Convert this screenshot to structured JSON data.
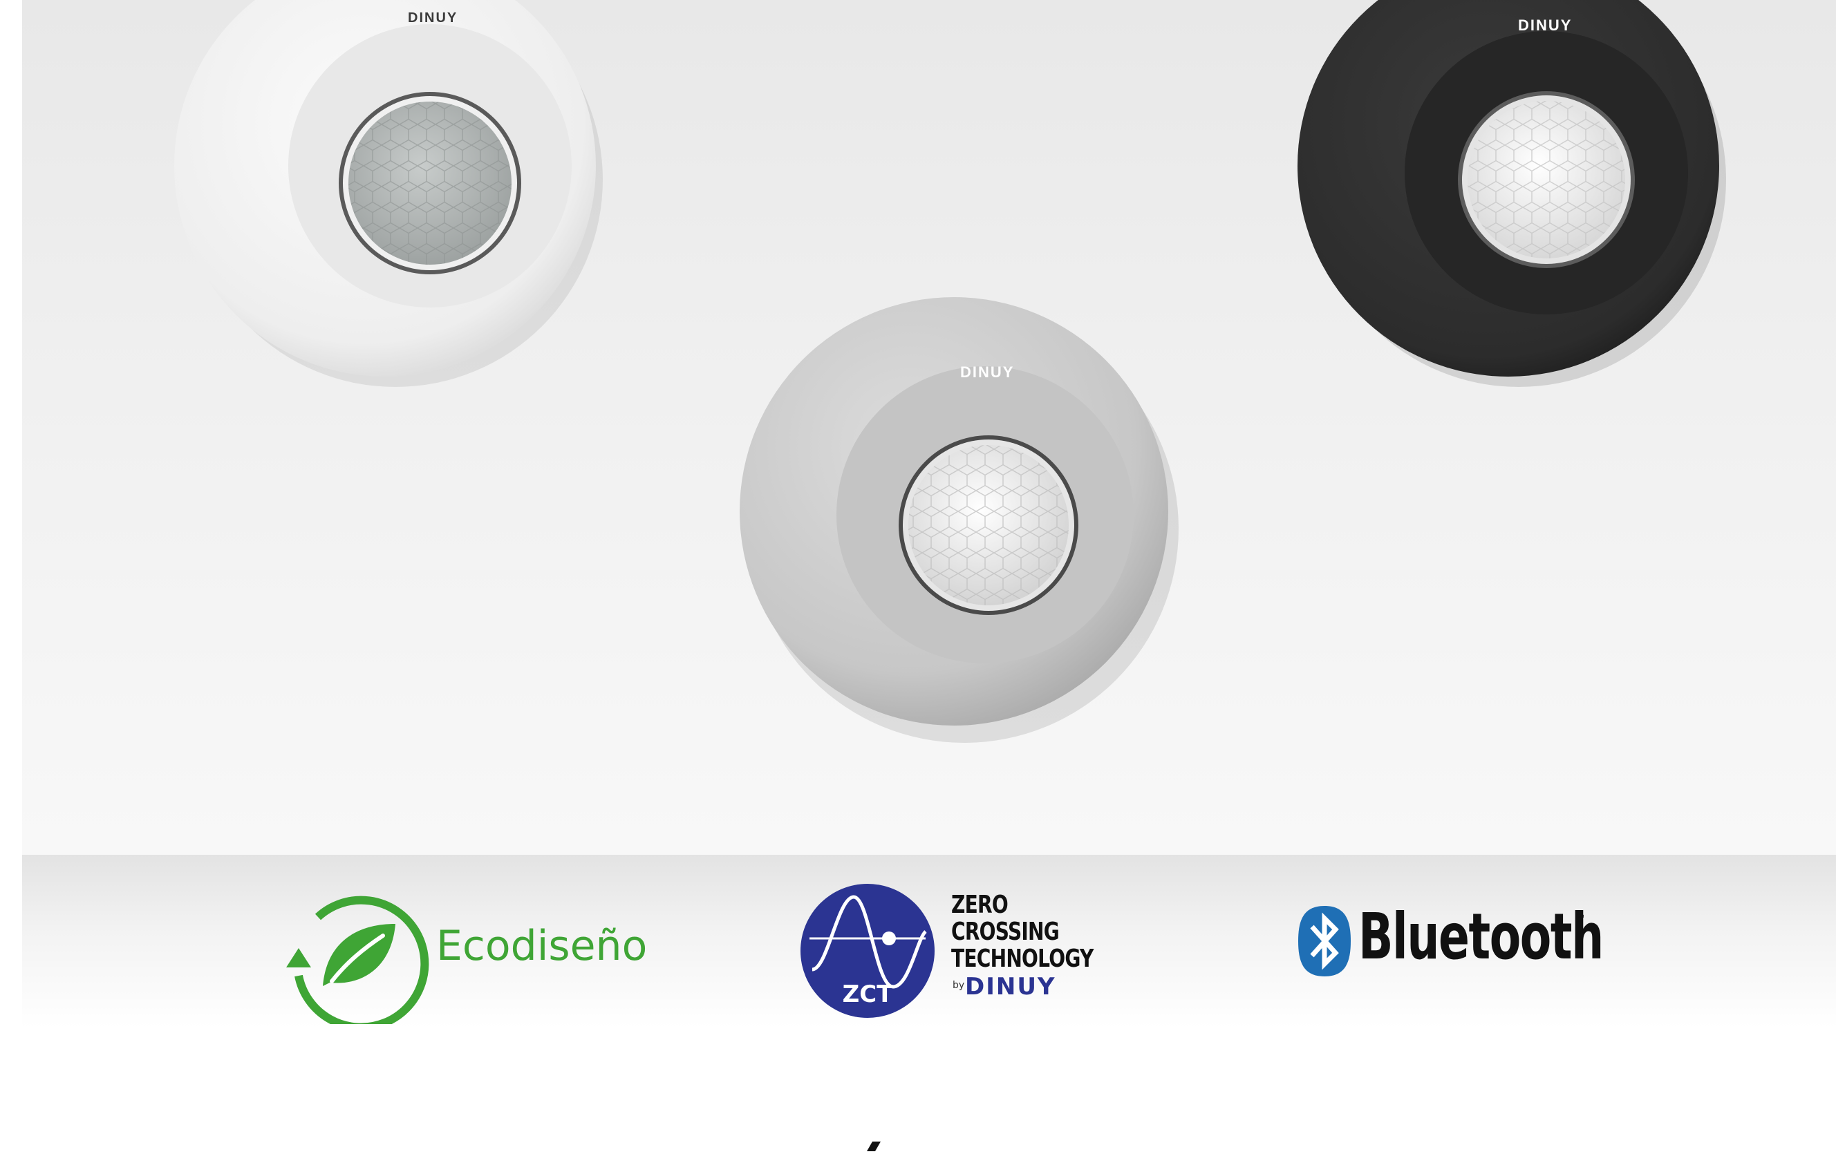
{
  "products": [
    {
      "name": "white-sensor",
      "brand": "DINUY",
      "body_color": "#f2f2f2",
      "ring_color": "#e6e6e6",
      "lens_color": "#b9bdbb"
    },
    {
      "name": "silver-sensor",
      "brand": "DINUY",
      "body_color": "#cfcfcf",
      "ring_color": "#bdbdbd",
      "lens_color": "#ececec"
    },
    {
      "name": "black-sensor",
      "brand": "DINUY",
      "body_color": "#2f2f2f",
      "ring_color": "#272727",
      "lens_color": "#f0f0f0"
    }
  ],
  "badges": {
    "eco": {
      "label": "Ecodiseño",
      "color": "#3fa535",
      "icon": "recycle-leaf-icon"
    },
    "zct": {
      "emblem_text": "ZCT",
      "lines": [
        "ZERO",
        "CROSSING",
        "TECHNOLOGY"
      ],
      "by": "by",
      "brand": "DINUY",
      "color": "#2b3492",
      "icon": "sine-wave-icon"
    },
    "bluetooth": {
      "label": "Bluetooth",
      "tm": "™",
      "color": "#1f6fb5",
      "icon": "bluetooth-icon"
    }
  },
  "colors": {
    "background_top": "#e8e8e8",
    "background_bottom": "#ffffff"
  }
}
